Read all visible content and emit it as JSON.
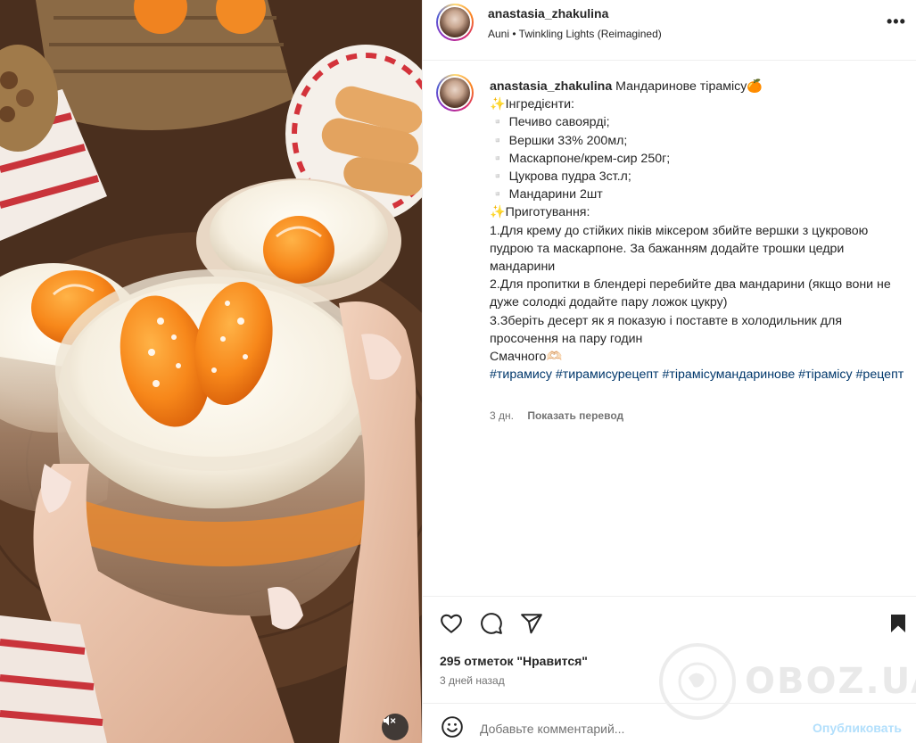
{
  "post": {
    "username": "anastasia_zhakulina",
    "music": "Auni • Twinkling Lights (Reimagined)",
    "more_glyph": "•••"
  },
  "caption": {
    "username": "anastasia_zhakulina",
    "title": "Мандаринове тірамісу🍊",
    "lines": [
      "✨Інгредієнти:",
      "▫️ Печиво савоярді;",
      "▫️ Вершки 33% 200мл;",
      "▫️ Маскарпоне/крем-сир 250г;",
      "▫️ Цукрова пудра 3ст.л;",
      "▫️ Мандарини 2шт",
      "✨Приготування:",
      "1.Для крему до стійких піків міксером збийте вершки з цукровою пудрою та маскарпоне. За бажанням додайте трошки цедри мандарини",
      "2.Для пропитки в блендері перебийте два мандарини (якщо вони не дуже солодкі додайте пару ложок цукру)",
      "3.Зберіть десерт як я показую і поставте в холодильник для просочення на пару годин",
      "Смачного🫶🏻"
    ],
    "hashtags": [
      "#тирамису",
      "#тирамисурецепт",
      "#тірамісумандаринове",
      "#тірамісу",
      "#рецепт"
    ],
    "age": "3 дн.",
    "translate_label": "Показать перевод"
  },
  "actions": {
    "likes_text": "295 отметок \"Нравится\"",
    "date_text": "3 дней назад"
  },
  "comment": {
    "placeholder": "Добавьте комментарий...",
    "post_label": "Опубликовать"
  },
  "watermark": {
    "text": "OBOZ.UA"
  },
  "colors": {
    "hashtag": "#00376b",
    "secondary_text": "#737373",
    "post_button_disabled": "#b2dffc",
    "divider": "#efefef"
  },
  "icons": [
    "heart-icon",
    "comment-icon",
    "share-icon",
    "bookmark-icon",
    "emoji-icon",
    "mute-icon",
    "more-icon"
  ]
}
